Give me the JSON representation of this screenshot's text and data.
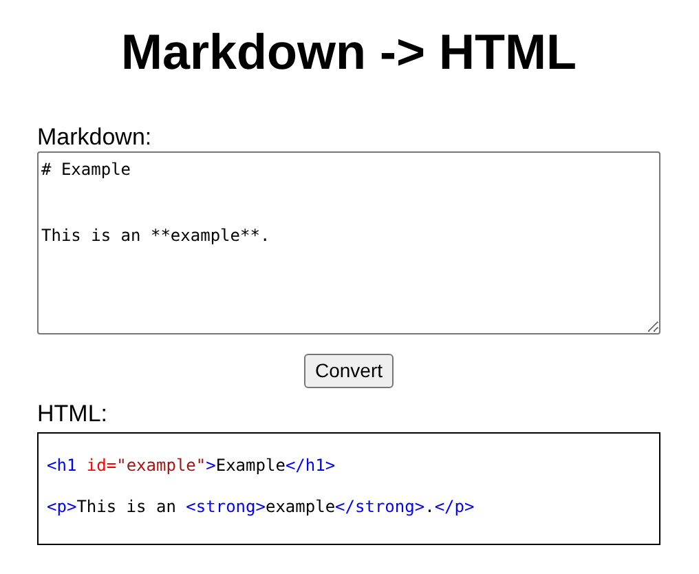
{
  "title": "Markdown -> HTML",
  "markdown": {
    "label": "Markdown:",
    "value": "# Example\n\nThis is an **example**."
  },
  "convert_button": "Convert",
  "html": {
    "label": "HTML:",
    "lines": [
      [
        {
          "kind": "tag",
          "text": "<h1 "
        },
        {
          "kind": "attr",
          "text": "id="
        },
        {
          "kind": "value",
          "text": "\"example\""
        },
        {
          "kind": "tag",
          "text": ">"
        },
        {
          "kind": "text",
          "text": "Example"
        },
        {
          "kind": "tag",
          "text": "</h1>"
        }
      ],
      [
        {
          "kind": "tag",
          "text": "<p>"
        },
        {
          "kind": "text",
          "text": "This is an "
        },
        {
          "kind": "tag",
          "text": "<strong>"
        },
        {
          "kind": "text",
          "text": "example"
        },
        {
          "kind": "tag",
          "text": "</strong>"
        },
        {
          "kind": "text",
          "text": "."
        },
        {
          "kind": "tag",
          "text": "</p>"
        }
      ]
    ]
  }
}
